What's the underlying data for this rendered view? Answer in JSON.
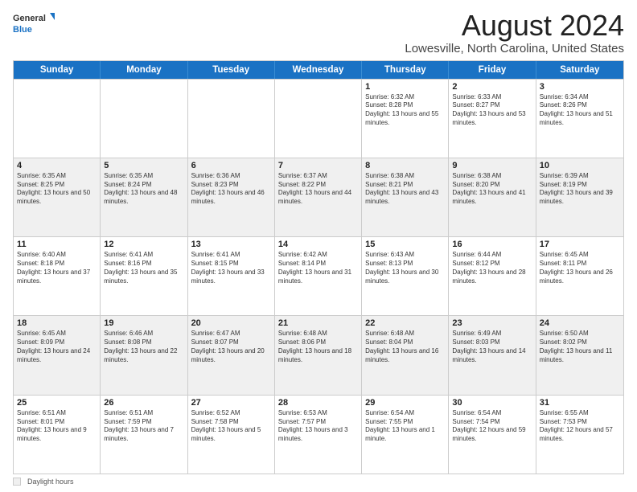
{
  "logo": {
    "general": "General",
    "blue": "Blue"
  },
  "title": "August 2024",
  "subtitle": "Lowesville, North Carolina, United States",
  "calendar": {
    "headers": [
      "Sunday",
      "Monday",
      "Tuesday",
      "Wednesday",
      "Thursday",
      "Friday",
      "Saturday"
    ],
    "weeks": [
      [
        {
          "day": "",
          "sunrise": "",
          "sunset": "",
          "daylight": "",
          "empty": true
        },
        {
          "day": "",
          "sunrise": "",
          "sunset": "",
          "daylight": "",
          "empty": true
        },
        {
          "day": "",
          "sunrise": "",
          "sunset": "",
          "daylight": "",
          "empty": true
        },
        {
          "day": "",
          "sunrise": "",
          "sunset": "",
          "daylight": "",
          "empty": true
        },
        {
          "day": "1",
          "sunrise": "Sunrise: 6:32 AM",
          "sunset": "Sunset: 8:28 PM",
          "daylight": "Daylight: 13 hours and 55 minutes.",
          "empty": false
        },
        {
          "day": "2",
          "sunrise": "Sunrise: 6:33 AM",
          "sunset": "Sunset: 8:27 PM",
          "daylight": "Daylight: 13 hours and 53 minutes.",
          "empty": false
        },
        {
          "day": "3",
          "sunrise": "Sunrise: 6:34 AM",
          "sunset": "Sunset: 8:26 PM",
          "daylight": "Daylight: 13 hours and 51 minutes.",
          "empty": false
        }
      ],
      [
        {
          "day": "4",
          "sunrise": "Sunrise: 6:35 AM",
          "sunset": "Sunset: 8:25 PM",
          "daylight": "Daylight: 13 hours and 50 minutes.",
          "empty": false
        },
        {
          "day": "5",
          "sunrise": "Sunrise: 6:35 AM",
          "sunset": "Sunset: 8:24 PM",
          "daylight": "Daylight: 13 hours and 48 minutes.",
          "empty": false
        },
        {
          "day": "6",
          "sunrise": "Sunrise: 6:36 AM",
          "sunset": "Sunset: 8:23 PM",
          "daylight": "Daylight: 13 hours and 46 minutes.",
          "empty": false
        },
        {
          "day": "7",
          "sunrise": "Sunrise: 6:37 AM",
          "sunset": "Sunset: 8:22 PM",
          "daylight": "Daylight: 13 hours and 44 minutes.",
          "empty": false
        },
        {
          "day": "8",
          "sunrise": "Sunrise: 6:38 AM",
          "sunset": "Sunset: 8:21 PM",
          "daylight": "Daylight: 13 hours and 43 minutes.",
          "empty": false
        },
        {
          "day": "9",
          "sunrise": "Sunrise: 6:38 AM",
          "sunset": "Sunset: 8:20 PM",
          "daylight": "Daylight: 13 hours and 41 minutes.",
          "empty": false
        },
        {
          "day": "10",
          "sunrise": "Sunrise: 6:39 AM",
          "sunset": "Sunset: 8:19 PM",
          "daylight": "Daylight: 13 hours and 39 minutes.",
          "empty": false
        }
      ],
      [
        {
          "day": "11",
          "sunrise": "Sunrise: 6:40 AM",
          "sunset": "Sunset: 8:18 PM",
          "daylight": "Daylight: 13 hours and 37 minutes.",
          "empty": false
        },
        {
          "day": "12",
          "sunrise": "Sunrise: 6:41 AM",
          "sunset": "Sunset: 8:16 PM",
          "daylight": "Daylight: 13 hours and 35 minutes.",
          "empty": false
        },
        {
          "day": "13",
          "sunrise": "Sunrise: 6:41 AM",
          "sunset": "Sunset: 8:15 PM",
          "daylight": "Daylight: 13 hours and 33 minutes.",
          "empty": false
        },
        {
          "day": "14",
          "sunrise": "Sunrise: 6:42 AM",
          "sunset": "Sunset: 8:14 PM",
          "daylight": "Daylight: 13 hours and 31 minutes.",
          "empty": false
        },
        {
          "day": "15",
          "sunrise": "Sunrise: 6:43 AM",
          "sunset": "Sunset: 8:13 PM",
          "daylight": "Daylight: 13 hours and 30 minutes.",
          "empty": false
        },
        {
          "day": "16",
          "sunrise": "Sunrise: 6:44 AM",
          "sunset": "Sunset: 8:12 PM",
          "daylight": "Daylight: 13 hours and 28 minutes.",
          "empty": false
        },
        {
          "day": "17",
          "sunrise": "Sunrise: 6:45 AM",
          "sunset": "Sunset: 8:11 PM",
          "daylight": "Daylight: 13 hours and 26 minutes.",
          "empty": false
        }
      ],
      [
        {
          "day": "18",
          "sunrise": "Sunrise: 6:45 AM",
          "sunset": "Sunset: 8:09 PM",
          "daylight": "Daylight: 13 hours and 24 minutes.",
          "empty": false
        },
        {
          "day": "19",
          "sunrise": "Sunrise: 6:46 AM",
          "sunset": "Sunset: 8:08 PM",
          "daylight": "Daylight: 13 hours and 22 minutes.",
          "empty": false
        },
        {
          "day": "20",
          "sunrise": "Sunrise: 6:47 AM",
          "sunset": "Sunset: 8:07 PM",
          "daylight": "Daylight: 13 hours and 20 minutes.",
          "empty": false
        },
        {
          "day": "21",
          "sunrise": "Sunrise: 6:48 AM",
          "sunset": "Sunset: 8:06 PM",
          "daylight": "Daylight: 13 hours and 18 minutes.",
          "empty": false
        },
        {
          "day": "22",
          "sunrise": "Sunrise: 6:48 AM",
          "sunset": "Sunset: 8:04 PM",
          "daylight": "Daylight: 13 hours and 16 minutes.",
          "empty": false
        },
        {
          "day": "23",
          "sunrise": "Sunrise: 6:49 AM",
          "sunset": "Sunset: 8:03 PM",
          "daylight": "Daylight: 13 hours and 14 minutes.",
          "empty": false
        },
        {
          "day": "24",
          "sunrise": "Sunrise: 6:50 AM",
          "sunset": "Sunset: 8:02 PM",
          "daylight": "Daylight: 13 hours and 11 minutes.",
          "empty": false
        }
      ],
      [
        {
          "day": "25",
          "sunrise": "Sunrise: 6:51 AM",
          "sunset": "Sunset: 8:01 PM",
          "daylight": "Daylight: 13 hours and 9 minutes.",
          "empty": false
        },
        {
          "day": "26",
          "sunrise": "Sunrise: 6:51 AM",
          "sunset": "Sunset: 7:59 PM",
          "daylight": "Daylight: 13 hours and 7 minutes.",
          "empty": false
        },
        {
          "day": "27",
          "sunrise": "Sunrise: 6:52 AM",
          "sunset": "Sunset: 7:58 PM",
          "daylight": "Daylight: 13 hours and 5 minutes.",
          "empty": false
        },
        {
          "day": "28",
          "sunrise": "Sunrise: 6:53 AM",
          "sunset": "Sunset: 7:57 PM",
          "daylight": "Daylight: 13 hours and 3 minutes.",
          "empty": false
        },
        {
          "day": "29",
          "sunrise": "Sunrise: 6:54 AM",
          "sunset": "Sunset: 7:55 PM",
          "daylight": "Daylight: 13 hours and 1 minute.",
          "empty": false
        },
        {
          "day": "30",
          "sunrise": "Sunrise: 6:54 AM",
          "sunset": "Sunset: 7:54 PM",
          "daylight": "Daylight: 12 hours and 59 minutes.",
          "empty": false
        },
        {
          "day": "31",
          "sunrise": "Sunrise: 6:55 AM",
          "sunset": "Sunset: 7:53 PM",
          "daylight": "Daylight: 12 hours and 57 minutes.",
          "empty": false
        }
      ]
    ]
  },
  "legend": {
    "label": "Daylight hours"
  }
}
